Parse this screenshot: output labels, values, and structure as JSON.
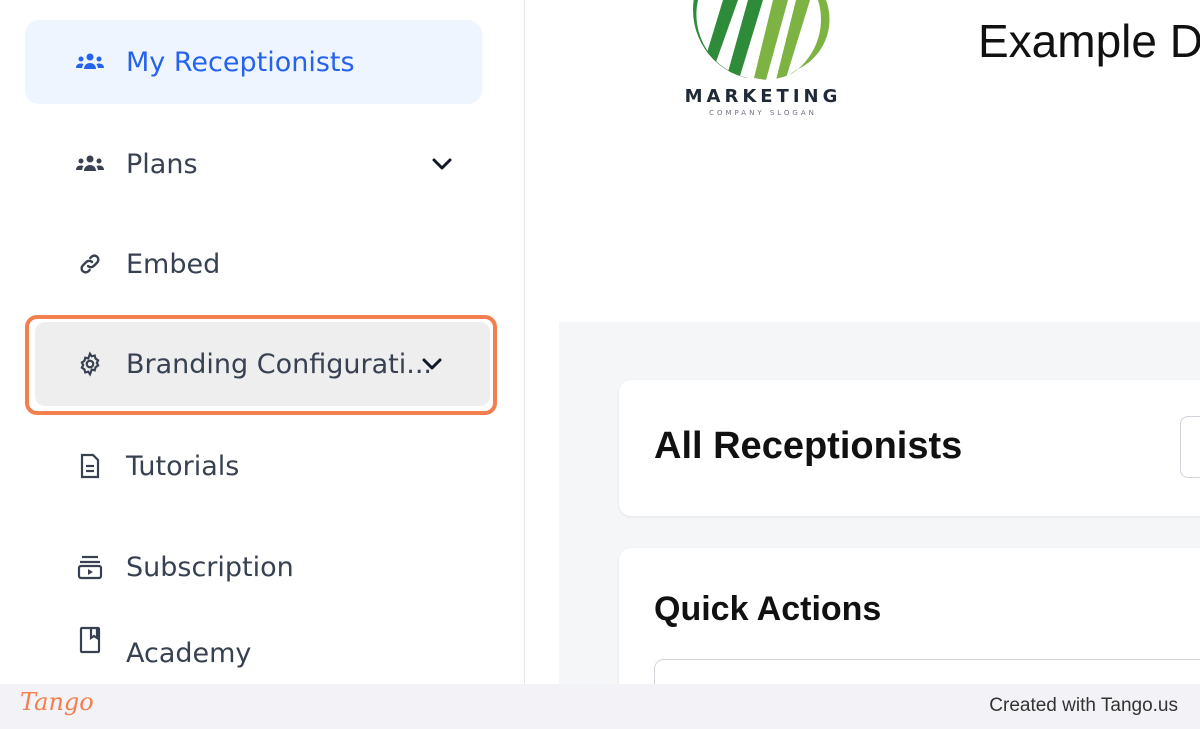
{
  "sidebar": {
    "items": [
      {
        "label": "My Receptionists",
        "icon": "users-icon"
      },
      {
        "label": "Plans",
        "icon": "users-icon"
      },
      {
        "label": "Embed",
        "icon": "link-icon"
      },
      {
        "label": "Branding Configurati...",
        "icon": "gear-icon"
      },
      {
        "label": "Tutorials",
        "icon": "document-icon"
      },
      {
        "label": "Subscription",
        "icon": "subscription-icon"
      },
      {
        "label": "Academy",
        "icon": "book-icon"
      }
    ]
  },
  "header": {
    "logo_word": "MARKETING",
    "logo_slogan": "COMPANY SLOGAN",
    "title": "Example D"
  },
  "main": {
    "all_receptionists_title": "All Receptionists",
    "quick_actions_title": "Quick Actions"
  },
  "footer": {
    "logo": "Tango",
    "credit": "Created with Tango.us"
  },
  "colors": {
    "accent": "#2563eb",
    "highlight": "#f37f4f",
    "logo_green": "#2e8b3a"
  }
}
